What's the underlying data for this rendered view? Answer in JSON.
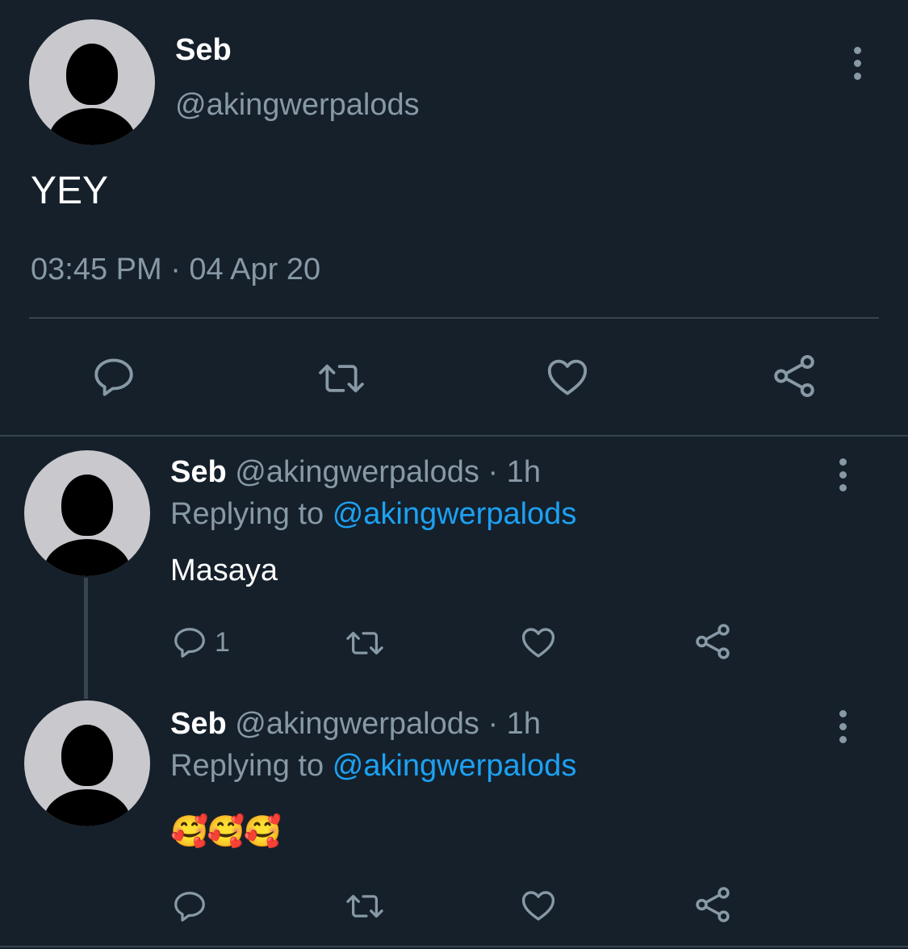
{
  "main_tweet": {
    "display_name": "Seb",
    "handle": "@akingwerpalods",
    "text": "YEY",
    "timestamp": "03:45 PM · 04 Apr 20",
    "actions": [
      "reply-icon",
      "retweet-icon",
      "like-icon",
      "share-icon"
    ]
  },
  "replies": [
    {
      "display_name": "Seb",
      "handle": "@akingwerpalods",
      "time": "· 1h",
      "replying_label": "Replying to",
      "replying_to": "@akingwerpalods",
      "text": "Masaya",
      "reply_count": "1"
    },
    {
      "display_name": "Seb",
      "handle": "@akingwerpalods",
      "time": "· 1h",
      "replying_label": "Replying to",
      "replying_to": "@akingwerpalods",
      "text": "🥰🥰🥰",
      "reply_count": ""
    }
  ],
  "colors": {
    "background": "#15202b",
    "muted": "#8899a6",
    "link": "#1da1f2",
    "divider": "#38444d"
  }
}
